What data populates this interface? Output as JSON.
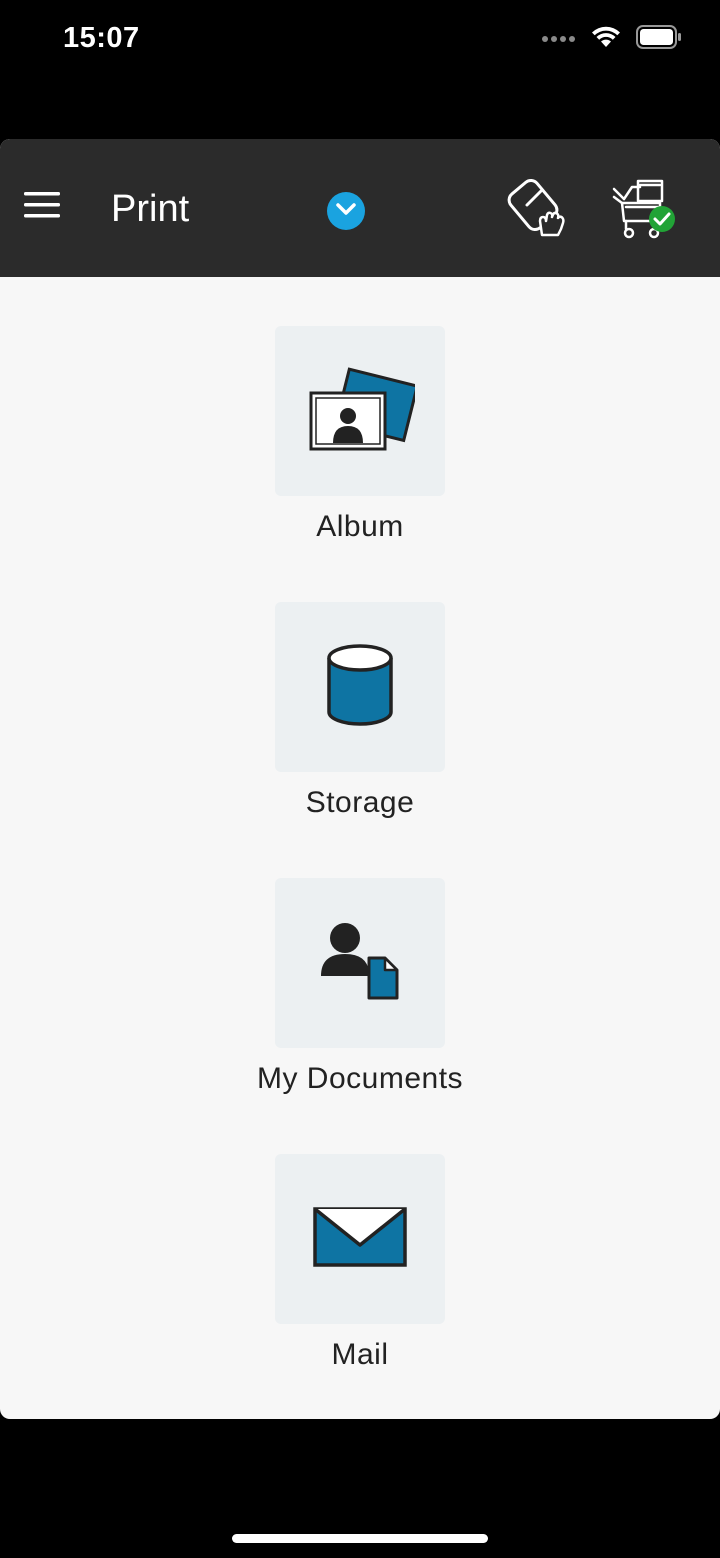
{
  "status_bar": {
    "time": "15:07"
  },
  "header": {
    "title": "Print",
    "icons": {
      "menu": "hamburger-menu-icon",
      "dropdown": "chevron-down-icon",
      "nfc": "nfc-touch-icon",
      "printer": "printer-connected-icon"
    }
  },
  "sources": [
    {
      "label": "Album",
      "icon": "album-photo-icon"
    },
    {
      "label": "Storage",
      "icon": "storage-cylinder-icon"
    },
    {
      "label": "My Documents",
      "icon": "my-documents-icon"
    },
    {
      "label": "Mail",
      "icon": "mail-envelope-icon"
    }
  ],
  "colors": {
    "accent_blue": "#1aa3e0",
    "icon_blue": "#0e74a3",
    "header_bg": "#2b2b2b",
    "tile_bg": "#ecf0f2",
    "status_ok_green": "#21a336"
  }
}
